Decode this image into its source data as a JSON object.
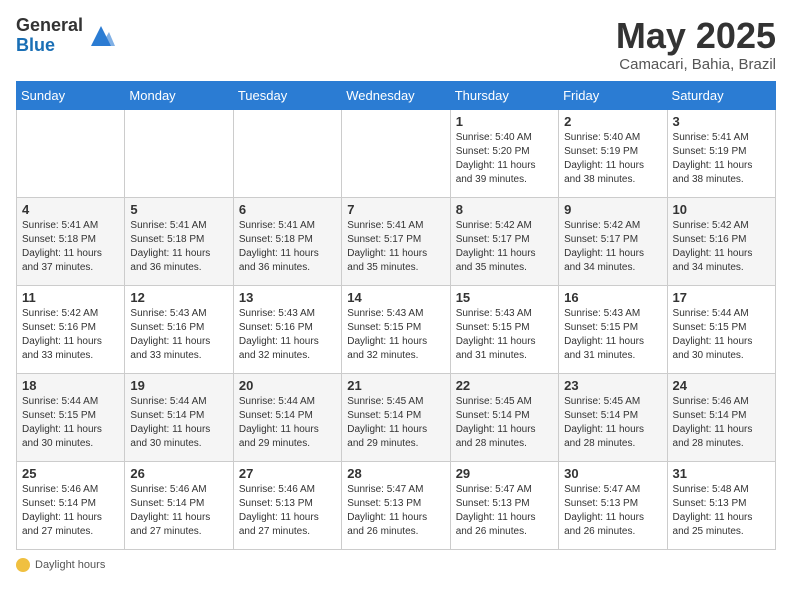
{
  "logo": {
    "general": "General",
    "blue": "Blue"
  },
  "title": "May 2025",
  "subtitle": "Camacari, Bahia, Brazil",
  "days_of_week": [
    "Sunday",
    "Monday",
    "Tuesday",
    "Wednesday",
    "Thursday",
    "Friday",
    "Saturday"
  ],
  "weeks": [
    [
      {
        "day": "",
        "info": ""
      },
      {
        "day": "",
        "info": ""
      },
      {
        "day": "",
        "info": ""
      },
      {
        "day": "",
        "info": ""
      },
      {
        "day": "1",
        "info": "Sunrise: 5:40 AM\nSunset: 5:20 PM\nDaylight: 11 hours and 39 minutes."
      },
      {
        "day": "2",
        "info": "Sunrise: 5:40 AM\nSunset: 5:19 PM\nDaylight: 11 hours and 38 minutes."
      },
      {
        "day": "3",
        "info": "Sunrise: 5:41 AM\nSunset: 5:19 PM\nDaylight: 11 hours and 38 minutes."
      }
    ],
    [
      {
        "day": "4",
        "info": "Sunrise: 5:41 AM\nSunset: 5:18 PM\nDaylight: 11 hours and 37 minutes."
      },
      {
        "day": "5",
        "info": "Sunrise: 5:41 AM\nSunset: 5:18 PM\nDaylight: 11 hours and 36 minutes."
      },
      {
        "day": "6",
        "info": "Sunrise: 5:41 AM\nSunset: 5:18 PM\nDaylight: 11 hours and 36 minutes."
      },
      {
        "day": "7",
        "info": "Sunrise: 5:41 AM\nSunset: 5:17 PM\nDaylight: 11 hours and 35 minutes."
      },
      {
        "day": "8",
        "info": "Sunrise: 5:42 AM\nSunset: 5:17 PM\nDaylight: 11 hours and 35 minutes."
      },
      {
        "day": "9",
        "info": "Sunrise: 5:42 AM\nSunset: 5:17 PM\nDaylight: 11 hours and 34 minutes."
      },
      {
        "day": "10",
        "info": "Sunrise: 5:42 AM\nSunset: 5:16 PM\nDaylight: 11 hours and 34 minutes."
      }
    ],
    [
      {
        "day": "11",
        "info": "Sunrise: 5:42 AM\nSunset: 5:16 PM\nDaylight: 11 hours and 33 minutes."
      },
      {
        "day": "12",
        "info": "Sunrise: 5:43 AM\nSunset: 5:16 PM\nDaylight: 11 hours and 33 minutes."
      },
      {
        "day": "13",
        "info": "Sunrise: 5:43 AM\nSunset: 5:16 PM\nDaylight: 11 hours and 32 minutes."
      },
      {
        "day": "14",
        "info": "Sunrise: 5:43 AM\nSunset: 5:15 PM\nDaylight: 11 hours and 32 minutes."
      },
      {
        "day": "15",
        "info": "Sunrise: 5:43 AM\nSunset: 5:15 PM\nDaylight: 11 hours and 31 minutes."
      },
      {
        "day": "16",
        "info": "Sunrise: 5:43 AM\nSunset: 5:15 PM\nDaylight: 11 hours and 31 minutes."
      },
      {
        "day": "17",
        "info": "Sunrise: 5:44 AM\nSunset: 5:15 PM\nDaylight: 11 hours and 30 minutes."
      }
    ],
    [
      {
        "day": "18",
        "info": "Sunrise: 5:44 AM\nSunset: 5:15 PM\nDaylight: 11 hours and 30 minutes."
      },
      {
        "day": "19",
        "info": "Sunrise: 5:44 AM\nSunset: 5:14 PM\nDaylight: 11 hours and 30 minutes."
      },
      {
        "day": "20",
        "info": "Sunrise: 5:44 AM\nSunset: 5:14 PM\nDaylight: 11 hours and 29 minutes."
      },
      {
        "day": "21",
        "info": "Sunrise: 5:45 AM\nSunset: 5:14 PM\nDaylight: 11 hours and 29 minutes."
      },
      {
        "day": "22",
        "info": "Sunrise: 5:45 AM\nSunset: 5:14 PM\nDaylight: 11 hours and 28 minutes."
      },
      {
        "day": "23",
        "info": "Sunrise: 5:45 AM\nSunset: 5:14 PM\nDaylight: 11 hours and 28 minutes."
      },
      {
        "day": "24",
        "info": "Sunrise: 5:46 AM\nSunset: 5:14 PM\nDaylight: 11 hours and 28 minutes."
      }
    ],
    [
      {
        "day": "25",
        "info": "Sunrise: 5:46 AM\nSunset: 5:14 PM\nDaylight: 11 hours and 27 minutes."
      },
      {
        "day": "26",
        "info": "Sunrise: 5:46 AM\nSunset: 5:14 PM\nDaylight: 11 hours and 27 minutes."
      },
      {
        "day": "27",
        "info": "Sunrise: 5:46 AM\nSunset: 5:13 PM\nDaylight: 11 hours and 27 minutes."
      },
      {
        "day": "28",
        "info": "Sunrise: 5:47 AM\nSunset: 5:13 PM\nDaylight: 11 hours and 26 minutes."
      },
      {
        "day": "29",
        "info": "Sunrise: 5:47 AM\nSunset: 5:13 PM\nDaylight: 11 hours and 26 minutes."
      },
      {
        "day": "30",
        "info": "Sunrise: 5:47 AM\nSunset: 5:13 PM\nDaylight: 11 hours and 26 minutes."
      },
      {
        "day": "31",
        "info": "Sunrise: 5:48 AM\nSunset: 5:13 PM\nDaylight: 11 hours and 25 minutes."
      }
    ]
  ],
  "footer": {
    "daylight_label": "Daylight hours"
  }
}
